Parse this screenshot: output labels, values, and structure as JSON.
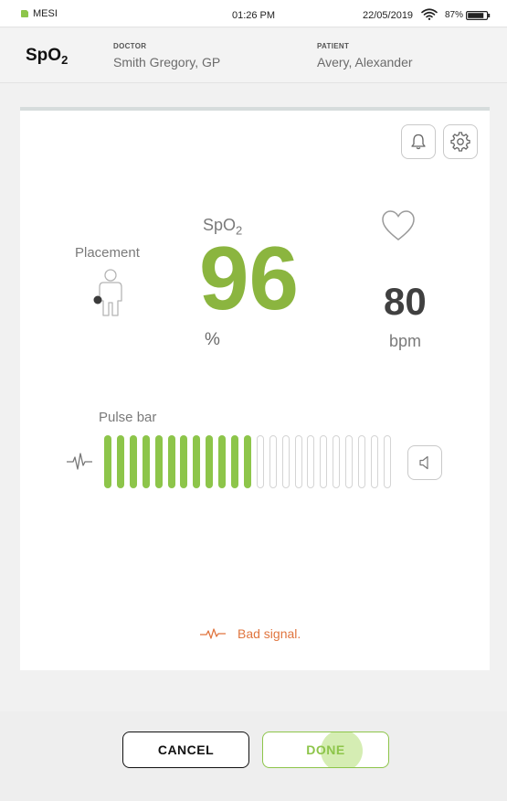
{
  "status_bar": {
    "brand": "MESI",
    "time": "01:26 PM",
    "date": "22/05/2019",
    "battery_percent": "87%",
    "battery_level": 0.87,
    "icons": [
      "mesi-logo-icon",
      "wifi-icon",
      "battery-icon"
    ]
  },
  "header": {
    "title_main": "SpO",
    "title_sub": "2",
    "doctor_label": "DOCTOR",
    "doctor_name": "Smith Gregory, GP",
    "patient_label": "PATIENT",
    "patient_name": "Avery, Alexander"
  },
  "measurement": {
    "alarm_icon": "bell-icon",
    "settings_icon": "gear-icon",
    "placement_label": "Placement",
    "spo2_label_main": "SpO",
    "spo2_label_sub": "2",
    "spo2_value": "96",
    "spo2_unit": "%",
    "heart_rate_value": "80",
    "heart_rate_unit": "bpm",
    "pulse_bar_label": "Pulse bar",
    "pulse_bar_total": 23,
    "pulse_bar_filled": 12,
    "signal_status": "Bad signal."
  },
  "colors": {
    "accent_green": "#8dc54a",
    "value_green": "#8bb53f",
    "warning_orange": "#e0753f",
    "dark_text": "#404040"
  },
  "footer": {
    "cancel_label": "CANCEL",
    "done_label": "DONE"
  }
}
